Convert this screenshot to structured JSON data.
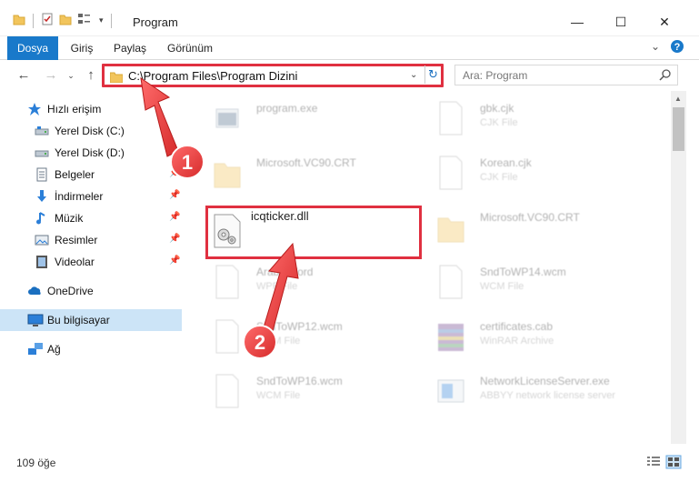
{
  "window": {
    "title": "Program",
    "controls": {
      "minimize": "—",
      "maximize": "☐",
      "close": "✕"
    }
  },
  "ribbon": {
    "tabs": [
      {
        "label": "Dosya",
        "active": true
      },
      {
        "label": "Giriş",
        "active": false
      },
      {
        "label": "Paylaş",
        "active": false
      },
      {
        "label": "Görünüm",
        "active": false
      }
    ]
  },
  "address": {
    "path": "C:\\Program Files\\Program Dizini",
    "refresh_icon": "↻"
  },
  "search": {
    "placeholder": "Ara: Program"
  },
  "sidebar": {
    "items": [
      {
        "label": "Hızlı erişim",
        "icon": "star-icon",
        "pinned": false
      },
      {
        "label": "Yerel Disk (C:)",
        "icon": "drive-icon",
        "pinned": false
      },
      {
        "label": "Yerel Disk (D:)",
        "icon": "drive-icon",
        "pinned": false
      },
      {
        "label": "Belgeler",
        "icon": "documents-icon",
        "pinned": true
      },
      {
        "label": "İndirmeler",
        "icon": "downloads-icon",
        "pinned": true
      },
      {
        "label": "Müzik",
        "icon": "music-icon",
        "pinned": true
      },
      {
        "label": "Resimler",
        "icon": "pictures-icon",
        "pinned": true
      },
      {
        "label": "Videolar",
        "icon": "videos-icon",
        "pinned": true
      },
      {
        "label": "OneDrive",
        "icon": "cloud-icon",
        "pinned": false
      },
      {
        "label": "Bu bilgisayar",
        "icon": "computer-icon",
        "pinned": false,
        "selected": true
      },
      {
        "label": "Ağ",
        "icon": "network-icon",
        "pinned": false
      }
    ]
  },
  "files": [
    {
      "name": "program.exe",
      "type": "",
      "icon": "exe-icon",
      "faded": true
    },
    {
      "name": "gbk.cjk",
      "type": "CJK File",
      "icon": "file-icon",
      "faded": true
    },
    {
      "name": "Microsoft.VC90.CRT",
      "type": "",
      "icon": "folder-icon",
      "faded": true
    },
    {
      "name": "Korean.cjk",
      "type": "CJK File",
      "icon": "file-icon",
      "faded": true
    },
    {
      "name": "icqticker.dll",
      "type": "",
      "icon": "dll-icon",
      "faded": false
    },
    {
      "name": "Microsoft.VC90.CRT",
      "type": "",
      "icon": "folder-icon",
      "faded": true
    },
    {
      "name": "ArabicWord",
      "type": "WPF File",
      "icon": "file-icon",
      "faded": true
    },
    {
      "name": "SndToWP14.wcm",
      "type": "WCM File",
      "icon": "file-icon",
      "faded": true
    },
    {
      "name": "SndToWP12.wcm",
      "type": "WCM File",
      "icon": "file-icon",
      "faded": true
    },
    {
      "name": "certificates.cab",
      "type": "WinRAR Archive",
      "icon": "archive-icon",
      "faded": true
    },
    {
      "name": "SndToWP16.wcm",
      "type": "WCM File",
      "icon": "file-icon",
      "faded": true
    },
    {
      "name": "NetworkLicenseServer.exe",
      "type": "ABBYY network license server",
      "icon": "exe-icon",
      "faded": true
    }
  ],
  "annotations": {
    "step1": "1",
    "step2": "2"
  },
  "status": {
    "item_count": "109 öğe"
  },
  "colors": {
    "accent": "#1979ca",
    "highlight": "#e03040",
    "selected": "#cce4f7"
  }
}
